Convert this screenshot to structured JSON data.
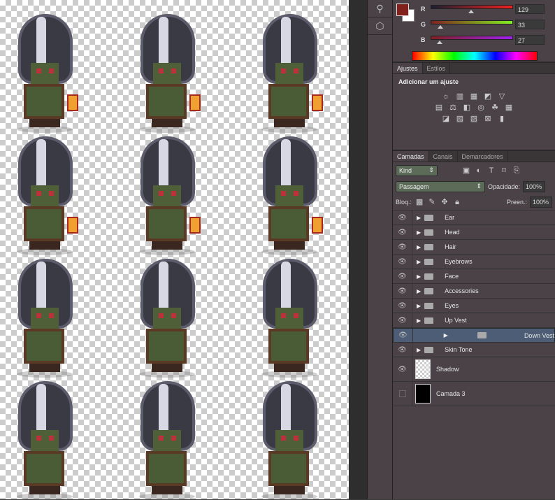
{
  "color": {
    "fg": "#81211b",
    "channels": [
      {
        "label": "R",
        "value": "129"
      },
      {
        "label": "G",
        "value": "33"
      },
      {
        "label": "B",
        "value": "27"
      }
    ]
  },
  "adjustments": {
    "tabs": [
      "Ajustes",
      "Estilos"
    ],
    "title": "Adicionar um ajuste"
  },
  "layers": {
    "tabs": [
      "Camadas",
      "Canais",
      "Demarcadores"
    ],
    "filter": "Kind",
    "blend": "Passagem",
    "opacity_label": "Opacidade:",
    "opacity": "100%",
    "lock_label": "Bloq.:",
    "fill_label": "Preen.:",
    "fill": "100%",
    "items": [
      {
        "name": "Ear"
      },
      {
        "name": "Head"
      },
      {
        "name": "Hair"
      },
      {
        "name": "Eyebrows"
      },
      {
        "name": "Face"
      },
      {
        "name": "Accessories"
      },
      {
        "name": "Eyes"
      },
      {
        "name": "Up Vest"
      },
      {
        "name": "Down Vest",
        "selected": true
      },
      {
        "name": "Skin Tone"
      }
    ],
    "shadow": "Shadow",
    "camada3": "Camada 3"
  }
}
